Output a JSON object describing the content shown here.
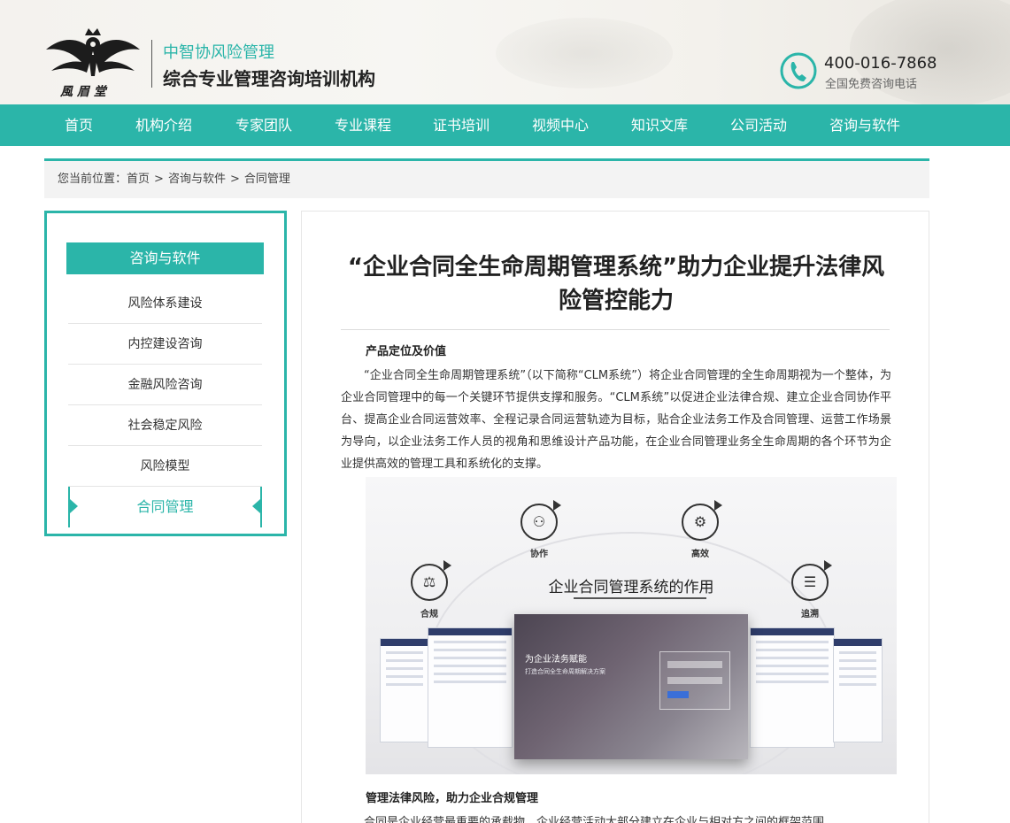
{
  "header": {
    "brand_line1": "中智协风险管理",
    "brand_line2": "综合专业管理咨询培训机构",
    "phone_number": "400-016-7868",
    "phone_caption": "全国免费咨询电话"
  },
  "nav": {
    "items": [
      "首页",
      "机构介绍",
      "专家团队",
      "专业课程",
      "证书培训",
      "视频中心",
      "知识文库",
      "公司活动",
      "咨询与软件"
    ]
  },
  "breadcrumb": {
    "prefix": "您当前位置：",
    "items": [
      "首页",
      "咨询与软件",
      "合同管理"
    ],
    "separator": ">"
  },
  "sidebar": {
    "title": "咨询与软件",
    "items": [
      "风险体系建设",
      "内控建设咨询",
      "金融风险咨询",
      "社会稳定风险",
      "风险模型",
      "合同管理"
    ],
    "active_index": 5
  },
  "article": {
    "title": "“企业合同全生命周期管理系统”助力企业提升法律风险管控能力",
    "section1_heading": "产品定位及价值",
    "section1_body": "“企业合同全生命周期管理系统”（以下简称“CLM系统”）将企业合同管理的全生命周期视为一个整体，为企业合同管理中的每一个关键环节提供支撑和服务。“CLM系统”以促进企业法律合规、建立企业合同协作平台、提高企业合同运营效率、全程记录合同运营轨迹为目标，贴合企业法务工作及合同管理、运营工作场景为导向，以企业法务工作人员的视角和思维设计产品功能，在企业合同管理业务全生命周期的各个环节为企业提供高效的管理工具和系统化的支撑。",
    "illustration": {
      "title": "企业合同管理系统的作用",
      "features": [
        "协作",
        "高效",
        "合规",
        "追溯"
      ],
      "screen_title": "为企业法务赋能",
      "screen_subtitle": "打造合同全生命周期解决方案"
    },
    "section2_heading": "管理法律风险，助力企业合规管理",
    "section2_body": "合同是企业经营最重要的承载物，企业经营活动大部分建立在企业与相对方之间的框架范围"
  },
  "colors": {
    "accent": "#2bb5a9"
  }
}
